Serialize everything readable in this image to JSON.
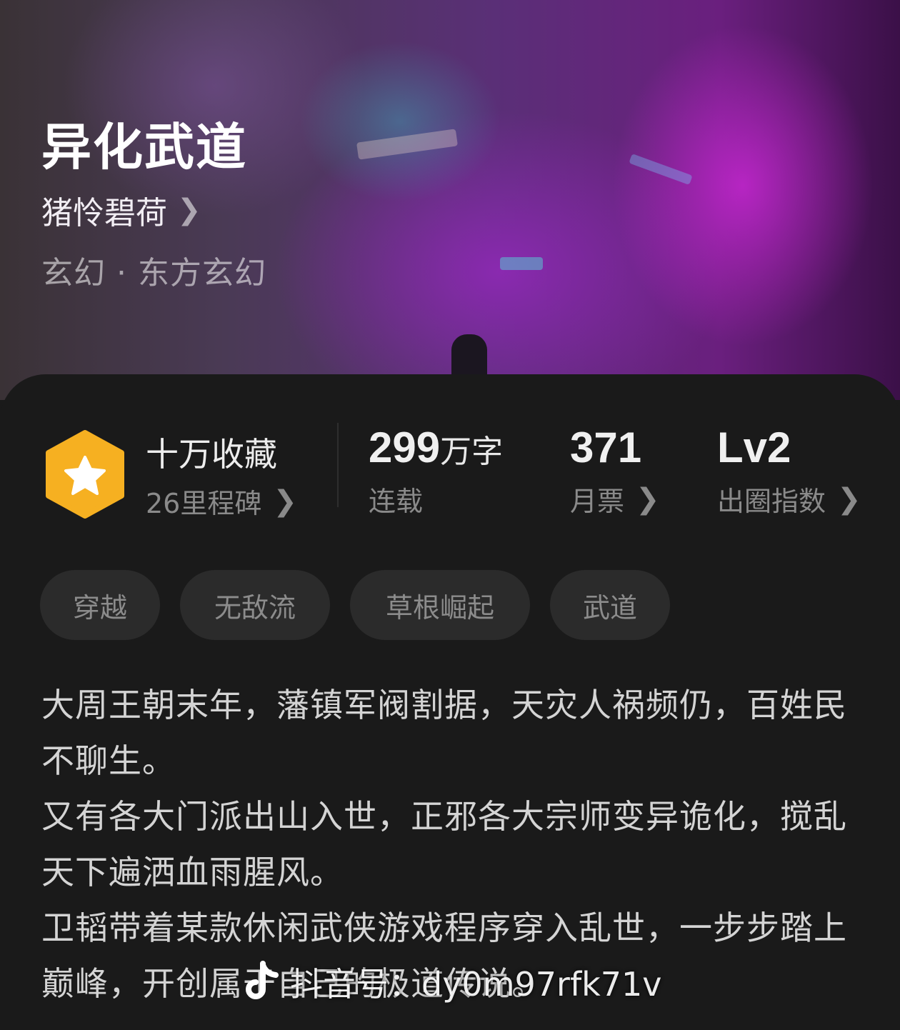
{
  "book": {
    "title": "异化武道",
    "author": "猪怜碧荷",
    "genre": "玄幻 · 东方玄幻"
  },
  "stats": {
    "collection": {
      "label": "十万收藏",
      "sub": "26里程碑"
    },
    "words": {
      "number": "299",
      "unit": "万字",
      "sub": "连载"
    },
    "monthly_votes": {
      "number": "371",
      "sub": "月票"
    },
    "popularity": {
      "number": "Lv2",
      "sub": "出圈指数"
    }
  },
  "tags": [
    "穿越",
    "无敌流",
    "草根崛起",
    "武道"
  ],
  "description": [
    "大周王朝末年，藩镇军阀割据，天灾人祸频仍，百姓民不聊生。",
    "又有各大门派出山入世，正邪各大宗师变异诡化，搅乱天下遍洒血雨腥风。",
    "卫韬带着某款休闲武侠游戏程序穿入乱世，一步步踏上巅峰，开创属于自己的极道传说。"
  ],
  "watermark": {
    "text": "抖音号：dy0m97rfk71v"
  },
  "colors": {
    "badge": "#f6b021",
    "panel": "#1a1a1a",
    "tag_bg": "#2b2b2b"
  },
  "icons": {
    "author_chevron": "chevron-right-icon",
    "badge": "star-hexagon-icon",
    "watermark": "douyin-logo-icon"
  }
}
